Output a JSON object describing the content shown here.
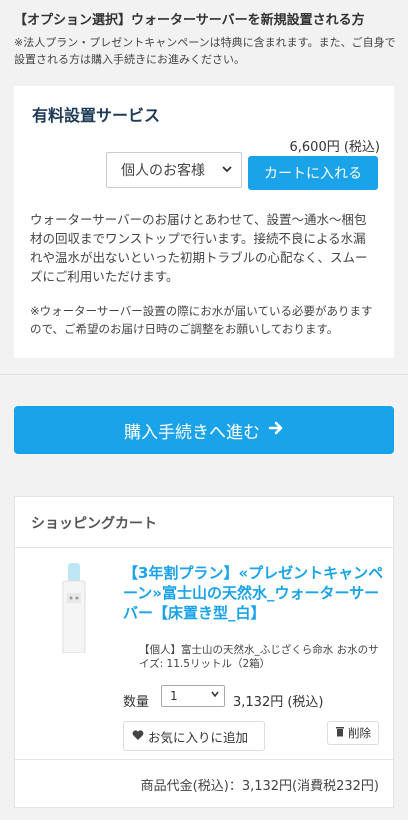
{
  "option_section": {
    "title": "【オプション選択】ウォーターサーバーを新規設置される方",
    "note": "※法人プラン・プレゼントキャンペーンは特典に含まれます。また、ご自身で設置される方は購入手続きにお進みください。"
  },
  "service": {
    "title": "有料設置サービス",
    "price": "6,600円 (税込)",
    "customer_type_selected": "個人のお客様",
    "add_to_cart_label": "カートに入れる",
    "description": "ウォーターサーバーのお届けとあわせて、設置〜通水〜梱包材の回収までワンストップで行います。接続不良による水漏れや温水が出ないといった初期トラブルの心配なく、スムーズにご利用いただけます。",
    "note": "※ウォーターサーバー設置の際にお水が届いている必要がありますので、ご希望のお届け日時のご調整をお願いしております。"
  },
  "checkout": {
    "label": "購入手続きへ進む",
    "icon": "arrow-right-icon"
  },
  "cart": {
    "title": "ショッピングカート",
    "item": {
      "name": "【3年割プラン】«プレゼントキャンペーン»富士山の天然水_ウォーターサーバー【床置き型_白】",
      "detail": "【個人】富士山の天然水_ふじざくら命水 お水のサイズ: 11.5リットル（2箱）",
      "qty_label": "数量",
      "qty_value": "1",
      "unit_price": "3,132円 (税込)",
      "favorite_label": "お気に入りに追加",
      "delete_label": "削除"
    },
    "subtotal": "商品代金(税込)：3,132円(消費税232円)"
  },
  "colors": {
    "accent": "#1aa3e8",
    "title_dark": "#1f3a57",
    "background": "#f2f2f2"
  }
}
